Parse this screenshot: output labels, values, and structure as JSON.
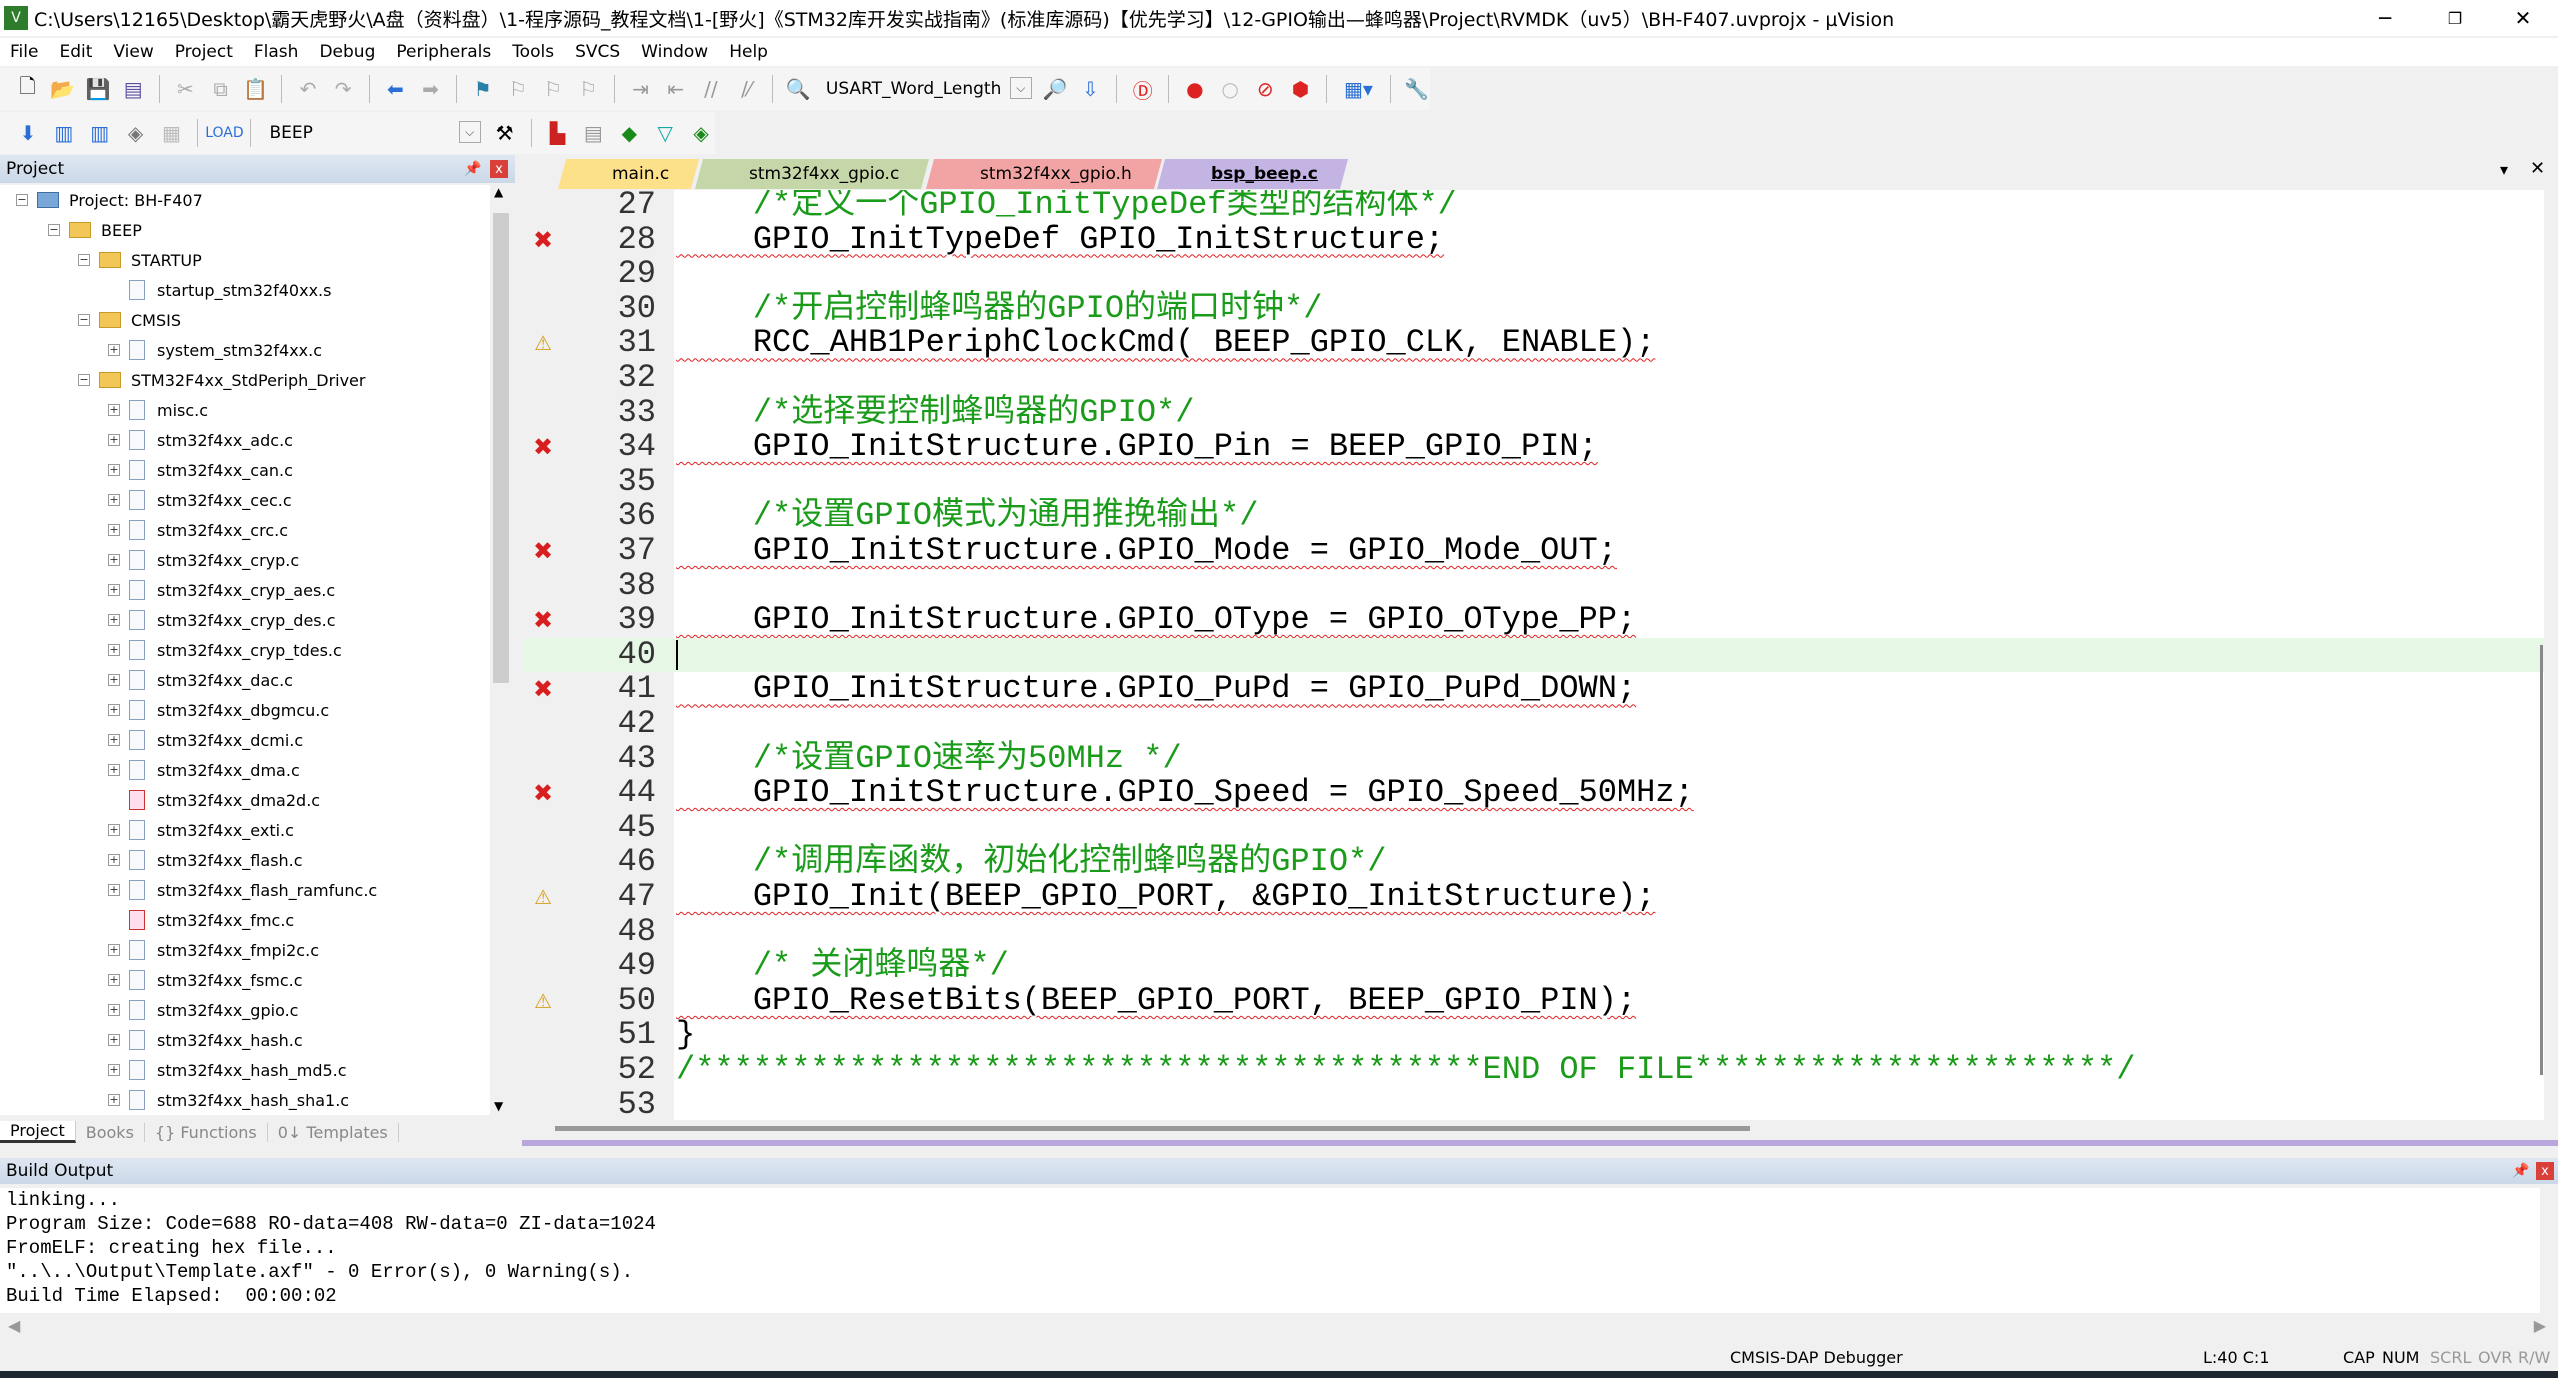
{
  "window": {
    "title": "C:\\Users\\12165\\Desktop\\霸天虎野火\\A盘（资料盘）\\1-程序源码_教程文档\\1-[野火]《STM32库开发实战指南》(标准库源码)【优先学习】\\12-GPIO输出—蜂鸣器\\Project\\RVMDK（uv5）\\BH-F407.uvprojx - µVision",
    "minimize": "─",
    "restore": "❐",
    "close": "✕"
  },
  "menu": [
    "File",
    "Edit",
    "View",
    "Project",
    "Flash",
    "Debug",
    "Peripherals",
    "Tools",
    "SVCS",
    "Window",
    "Help"
  ],
  "toolbar": {
    "find_combo": "USART_Word_Length",
    "target_combo": "BEEP"
  },
  "project_panel": {
    "title": "Project",
    "pin": "📌",
    "close": "x",
    "tree": [
      {
        "label": "Project: BH-F407",
        "level": 0,
        "type": "root",
        "exp": "−"
      },
      {
        "label": "BEEP",
        "level": 1,
        "type": "folder",
        "exp": "−"
      },
      {
        "label": "STARTUP",
        "level": 2,
        "type": "folder",
        "exp": "−"
      },
      {
        "label": "startup_stm32f40xx.s",
        "level": 3,
        "type": "file",
        "exp": ""
      },
      {
        "label": "CMSIS",
        "level": 2,
        "type": "folder",
        "exp": "−"
      },
      {
        "label": "system_stm32f4xx.c",
        "level": 3,
        "type": "file",
        "exp": "+"
      },
      {
        "label": "STM32F4xx_StdPeriph_Driver",
        "level": 2,
        "type": "folder",
        "exp": "−"
      },
      {
        "label": "misc.c",
        "level": 3,
        "type": "file",
        "exp": "+"
      },
      {
        "label": "stm32f4xx_adc.c",
        "level": 3,
        "type": "file",
        "exp": "+"
      },
      {
        "label": "stm32f4xx_can.c",
        "level": 3,
        "type": "file",
        "exp": "+"
      },
      {
        "label": "stm32f4xx_cec.c",
        "level": 3,
        "type": "file",
        "exp": "+"
      },
      {
        "label": "stm32f4xx_crc.c",
        "level": 3,
        "type": "file",
        "exp": "+"
      },
      {
        "label": "stm32f4xx_cryp.c",
        "level": 3,
        "type": "file",
        "exp": "+"
      },
      {
        "label": "stm32f4xx_cryp_aes.c",
        "level": 3,
        "type": "file",
        "exp": "+"
      },
      {
        "label": "stm32f4xx_cryp_des.c",
        "level": 3,
        "type": "file",
        "exp": "+"
      },
      {
        "label": "stm32f4xx_cryp_tdes.c",
        "level": 3,
        "type": "file",
        "exp": "+"
      },
      {
        "label": "stm32f4xx_dac.c",
        "level": 3,
        "type": "file",
        "exp": "+"
      },
      {
        "label": "stm32f4xx_dbgmcu.c",
        "level": 3,
        "type": "file",
        "exp": "+"
      },
      {
        "label": "stm32f4xx_dcmi.c",
        "level": 3,
        "type": "file",
        "exp": "+"
      },
      {
        "label": "stm32f4xx_dma.c",
        "level": 3,
        "type": "file",
        "exp": "+"
      },
      {
        "label": "stm32f4xx_dma2d.c",
        "level": 3,
        "type": "excluded",
        "exp": ""
      },
      {
        "label": "stm32f4xx_exti.c",
        "level": 3,
        "type": "file",
        "exp": "+"
      },
      {
        "label": "stm32f4xx_flash.c",
        "level": 3,
        "type": "file",
        "exp": "+"
      },
      {
        "label": "stm32f4xx_flash_ramfunc.c",
        "level": 3,
        "type": "file",
        "exp": "+"
      },
      {
        "label": "stm32f4xx_fmc.c",
        "level": 3,
        "type": "excluded",
        "exp": ""
      },
      {
        "label": "stm32f4xx_fmpi2c.c",
        "level": 3,
        "type": "file",
        "exp": "+"
      },
      {
        "label": "stm32f4xx_fsmc.c",
        "level": 3,
        "type": "file",
        "exp": "+"
      },
      {
        "label": "stm32f4xx_gpio.c",
        "level": 3,
        "type": "file",
        "exp": "+"
      },
      {
        "label": "stm32f4xx_hash.c",
        "level": 3,
        "type": "file",
        "exp": "+"
      },
      {
        "label": "stm32f4xx_hash_md5.c",
        "level": 3,
        "type": "file",
        "exp": "+"
      },
      {
        "label": "stm32f4xx_hash_sha1.c",
        "level": 3,
        "type": "file",
        "exp": "+"
      }
    ],
    "tabs": [
      "Project",
      "Books",
      "{} Functions",
      "0↓ Templates"
    ]
  },
  "editor": {
    "tabs": [
      {
        "label": "main.c",
        "color": "#fde08a",
        "active": false
      },
      {
        "label": "stm32f4xx_gpio.c",
        "color": "#c5d6a8",
        "active": false
      },
      {
        "label": "stm32f4xx_gpio.h",
        "color": "#f2a4a4",
        "active": false
      },
      {
        "label": "bsp_beep.c",
        "color": "#c4b4e4",
        "active": true
      }
    ],
    "current_line": 40,
    "lines": [
      {
        "n": "27",
        "text": "    /*定义一个GPIO_InitTypeDef类型的结构体*/",
        "kind": "cm",
        "mark": ""
      },
      {
        "n": "28",
        "text": "    GPIO_InitTypeDef GPIO_InitStructure;",
        "kind": "sq",
        "mark": "err"
      },
      {
        "n": "29",
        "text": "",
        "kind": "",
        "mark": ""
      },
      {
        "n": "30",
        "text": "    /*开启控制蜂鸣器的GPIO的端口时钟*/",
        "kind": "cm",
        "mark": ""
      },
      {
        "n": "31",
        "text": "    RCC_AHB1PeriphClockCmd( BEEP_GPIO_CLK, ENABLE);",
        "kind": "sq",
        "mark": "warn"
      },
      {
        "n": "32",
        "text": "",
        "kind": "",
        "mark": ""
      },
      {
        "n": "33",
        "text": "    /*选择要控制蜂鸣器的GPIO*/",
        "kind": "cm",
        "mark": ""
      },
      {
        "n": "34",
        "text": "    GPIO_InitStructure.GPIO_Pin = BEEP_GPIO_PIN;",
        "kind": "sq",
        "mark": "err"
      },
      {
        "n": "35",
        "text": "",
        "kind": "",
        "mark": ""
      },
      {
        "n": "36",
        "text": "    /*设置GPIO模式为通用推挽输出*/",
        "kind": "cm",
        "mark": ""
      },
      {
        "n": "37",
        "text": "    GPIO_InitStructure.GPIO_Mode = GPIO_Mode_OUT;",
        "kind": "sq",
        "mark": "err"
      },
      {
        "n": "38",
        "text": "",
        "kind": "",
        "mark": ""
      },
      {
        "n": "39",
        "text": "    GPIO_InitStructure.GPIO_OType = GPIO_OType_PP;",
        "kind": "sq",
        "mark": "err"
      },
      {
        "n": "40",
        "text": "",
        "kind": "",
        "mark": ""
      },
      {
        "n": "41",
        "text": "    GPIO_InitStructure.GPIO_PuPd = GPIO_PuPd_DOWN;",
        "kind": "sq",
        "mark": "err"
      },
      {
        "n": "42",
        "text": "",
        "kind": "",
        "mark": ""
      },
      {
        "n": "43",
        "text": "    /*设置GPIO速率为50MHz */",
        "kind": "cm",
        "mark": ""
      },
      {
        "n": "44",
        "text": "    GPIO_InitStructure.GPIO_Speed = GPIO_Speed_50MHz;",
        "kind": "sq",
        "mark": "err"
      },
      {
        "n": "45",
        "text": "",
        "kind": "",
        "mark": ""
      },
      {
        "n": "46",
        "text": "    /*调用库函数，初始化控制蜂鸣器的GPIO*/",
        "kind": "cm",
        "mark": ""
      },
      {
        "n": "47",
        "text": "    GPIO_Init(BEEP_GPIO_PORT, &GPIO_InitStructure);",
        "kind": "sq",
        "mark": "warn"
      },
      {
        "n": "48",
        "text": "",
        "kind": "",
        "mark": ""
      },
      {
        "n": "49",
        "text": "    /* 关闭蜂鸣器*/",
        "kind": "cm",
        "mark": ""
      },
      {
        "n": "50",
        "text": "    GPIO_ResetBits(BEEP_GPIO_PORT, BEEP_GPIO_PIN);",
        "kind": "sq",
        "mark": "warn"
      },
      {
        "n": "51",
        "text": "}",
        "kind": "",
        "mark": ""
      },
      {
        "n": "52",
        "text": "/*****************************************END OF FILE**********************/",
        "kind": "cm",
        "mark": ""
      },
      {
        "n": "53",
        "text": "",
        "kind": "",
        "mark": ""
      }
    ],
    "marks": {
      "err": "✖",
      "warn": "⚠"
    }
  },
  "build_output": {
    "title": "Build Output",
    "lines": [
      "linking...",
      "Program Size: Code=688 RO-data=408 RW-data=0 ZI-data=1024",
      "FromELF: creating hex file...",
      "\"..\\..\\Output\\Template.axf\" - 0 Error(s), 0 Warning(s).",
      "Build Time Elapsed:  00:00:02"
    ]
  },
  "status": {
    "debugger": "CMSIS-DAP Debugger",
    "position": "L:40 C:1",
    "cap": "CAP",
    "num": "NUM",
    "scrl": "SCRL",
    "ovr": "OVR",
    "rw": "R/W"
  }
}
